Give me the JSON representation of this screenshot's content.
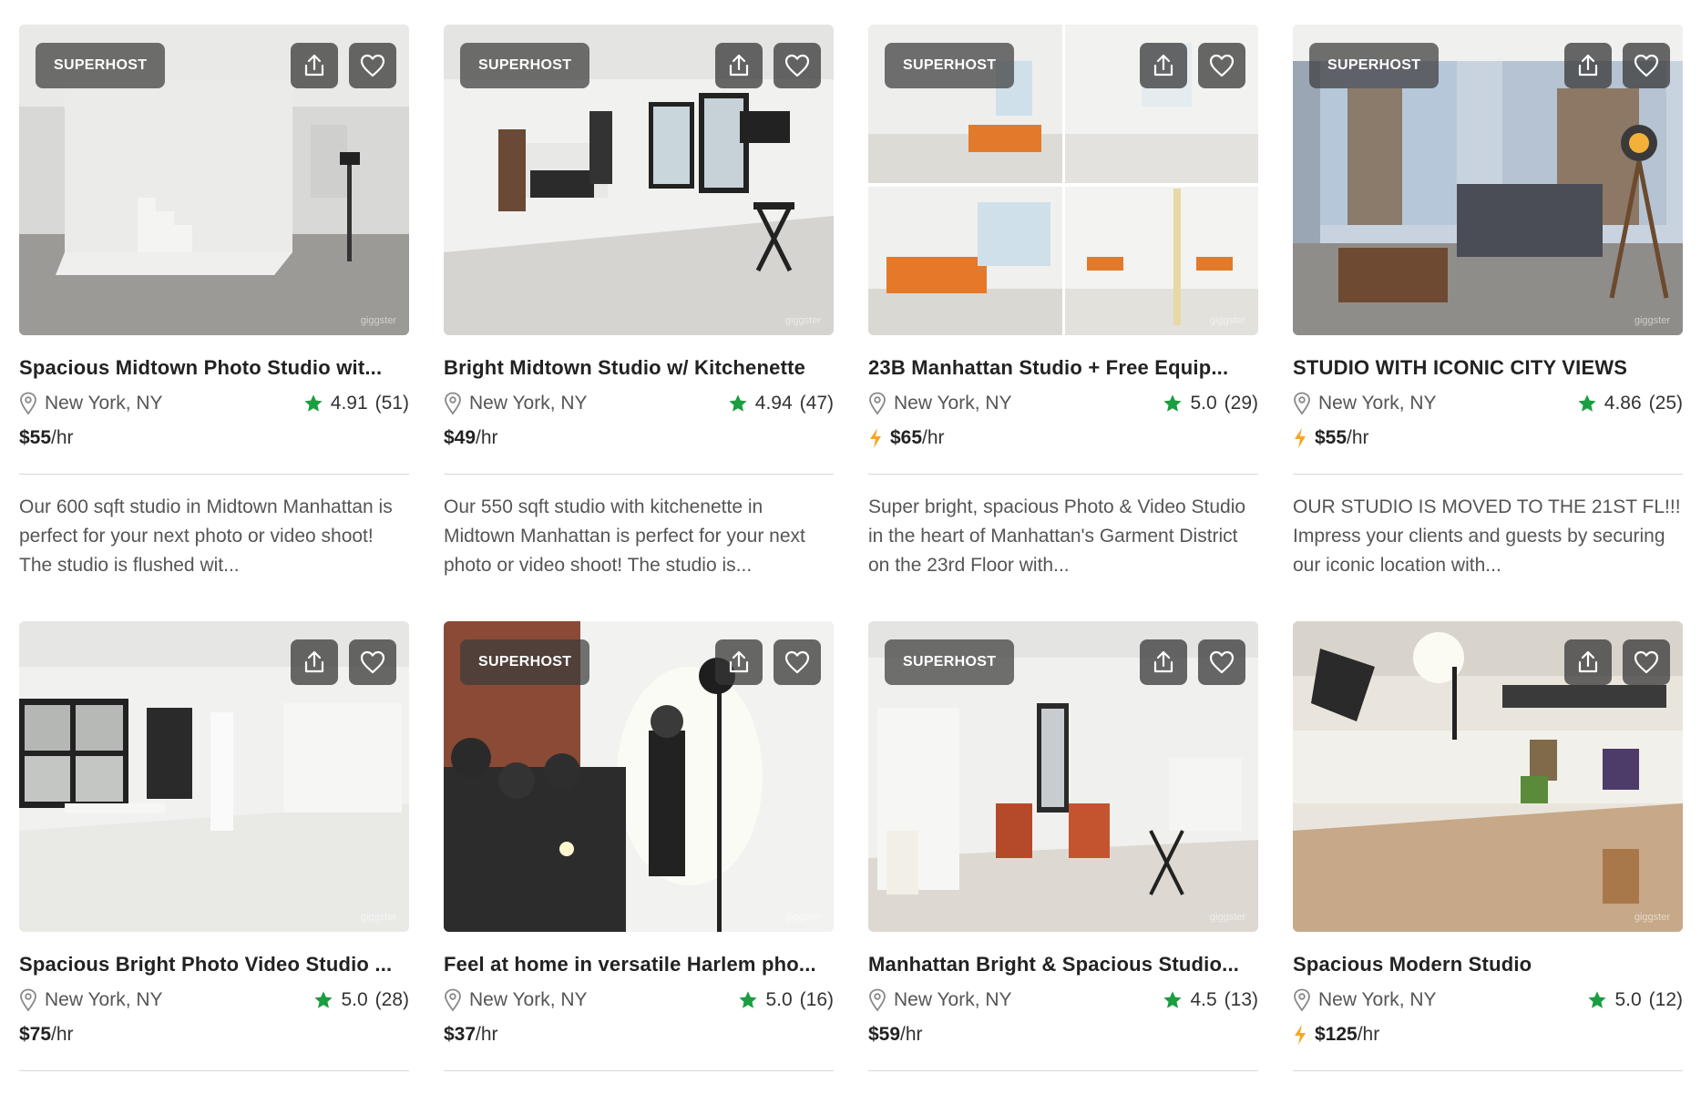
{
  "listings": [
    {
      "superhost": "SUPERHOST",
      "title": "Spacious Midtown Photo Studio wit...",
      "location": "New York, NY",
      "rating": "4.91",
      "reviews": "(51)",
      "instant": false,
      "price": "$55",
      "unit": "/hr",
      "description": "Our 600 sqft studio in Midtown Manhattan is perfect for your next photo or video shoot! The studio is flushed wit...",
      "watermark": "giggster"
    },
    {
      "superhost": "SUPERHOST",
      "title": "Bright Midtown Studio w/ Kitchenette",
      "location": "New York, NY",
      "rating": "4.94",
      "reviews": "(47)",
      "instant": false,
      "price": "$49",
      "unit": "/hr",
      "description": "Our 550 sqft studio with kitchenette in Midtown Manhattan is perfect for your next photo or video shoot! The studio is...",
      "watermark": "giggster"
    },
    {
      "superhost": "SUPERHOST",
      "title": "23B Manhattan Studio + Free Equip...",
      "location": "New York, NY",
      "rating": "5.0",
      "reviews": "(29)",
      "instant": true,
      "price": "$65",
      "unit": "/hr",
      "description": "Super bright, spacious Photo & Video Studio in the heart of Manhattan's Garment District on the 23rd Floor with...",
      "watermark": "giggster"
    },
    {
      "superhost": "SUPERHOST",
      "title": "STUDIO WITH ICONIC CITY VIEWS",
      "location": "New York, NY",
      "rating": "4.86",
      "reviews": "(25)",
      "instant": true,
      "price": "$55",
      "unit": "/hr",
      "description": "OUR STUDIO IS MOVED TO THE 21ST FL!!! Impress your clients and guests by securing our iconic location with...",
      "watermark": "giggster"
    },
    {
      "superhost": "",
      "title": "Spacious Bright Photo Video Studio ...",
      "location": "New York, NY",
      "rating": "5.0",
      "reviews": "(28)",
      "instant": false,
      "price": "$75",
      "unit": "/hr",
      "description": "",
      "watermark": "giggster"
    },
    {
      "superhost": "SUPERHOST",
      "title": "Feel at home in versatile Harlem pho...",
      "location": "New York, NY",
      "rating": "5.0",
      "reviews": "(16)",
      "instant": false,
      "price": "$37",
      "unit": "/hr",
      "description": "",
      "watermark": "giggster"
    },
    {
      "superhost": "SUPERHOST",
      "title": "Manhattan Bright & Spacious Studio...",
      "location": "New York, NY",
      "rating": "4.5",
      "reviews": "(13)",
      "instant": false,
      "price": "$59",
      "unit": "/hr",
      "description": "",
      "watermark": "giggster"
    },
    {
      "superhost": "",
      "title": "Spacious Modern Studio",
      "location": "New York, NY",
      "rating": "5.0",
      "reviews": "(12)",
      "instant": true,
      "price": "$125",
      "unit": "/hr",
      "description": "",
      "watermark": "giggster"
    }
  ],
  "icons": {
    "share": "share-icon",
    "favorite": "heart-icon",
    "location": "map-pin-icon",
    "rating": "star-icon",
    "instant_book": "lightning-icon"
  },
  "colors": {
    "star": "#1a9e3f",
    "lightning": "#f5a623",
    "badge_bg": "#3c3c3c",
    "text": "#222222",
    "muted": "#555555",
    "divider": "#d9d9d9"
  }
}
